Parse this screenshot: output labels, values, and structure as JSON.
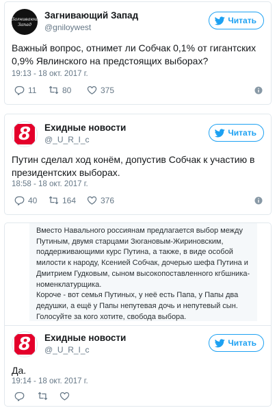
{
  "tweets": [
    {
      "name": "Загнивающий Запад",
      "handle": "@gniloywest",
      "avatar_text": "Загнивающий\nЗапад",
      "follow_label": "Читать",
      "text": "Важный вопрос, отнимет ли Собчак 0,1% от гигантских 0,9% Явлинского на предстоящих выборах?",
      "time": "19:13 - 18 окт. 2017 г.",
      "replies": "11",
      "retweets": "80",
      "likes": "375"
    },
    {
      "name": "Ехидные новости",
      "handle": "@_U_R_I_c",
      "avatar_text": "8",
      "follow_label": "Читать",
      "text": "Путин сделал ход конём, допустив Собчак к участию в президентских выборах.",
      "time": "18:58 - 18 окт. 2017 г.",
      "replies": "40",
      "retweets": "164",
      "likes": "376"
    },
    {
      "name": "Ехидные новости",
      "handle": "@_U_R_I_c",
      "avatar_text": "8",
      "follow_label": "Читать",
      "text": "Да.",
      "time": "19:14 - 18 окт. 2017 г.",
      "replies": "",
      "retweets": "",
      "likes": ""
    }
  ],
  "quote_text": "Вместо Навального россиянам предлагается выбор между\nПутиным, двумя старцами Зюгановым-Жириновским,\nподдерживающими курс Путина, а также, в виде особой\nмилости к народу, Ксенией Собчак, дочерью шефа Путина и\nДмитрием Гудковым, сыном высокопоставленного кгбшника-\nноменклатурщика.\nКороче - вот семья Путиных, у неё есть Папа, у Папы два\nдедушки, а ещё у Папы непутевая дочь и непутевый сын.\nГолосуйте за кого хотите, свобода выбора.",
  "icons": {
    "reply": "reply-icon",
    "retweet": "retweet-icon",
    "like": "heart-icon",
    "info": "info-icon",
    "follow": "twitter-bird-icon"
  },
  "colors": {
    "accent": "#1da1f2",
    "muted": "#657786",
    "brand_red": "#e4002b"
  }
}
